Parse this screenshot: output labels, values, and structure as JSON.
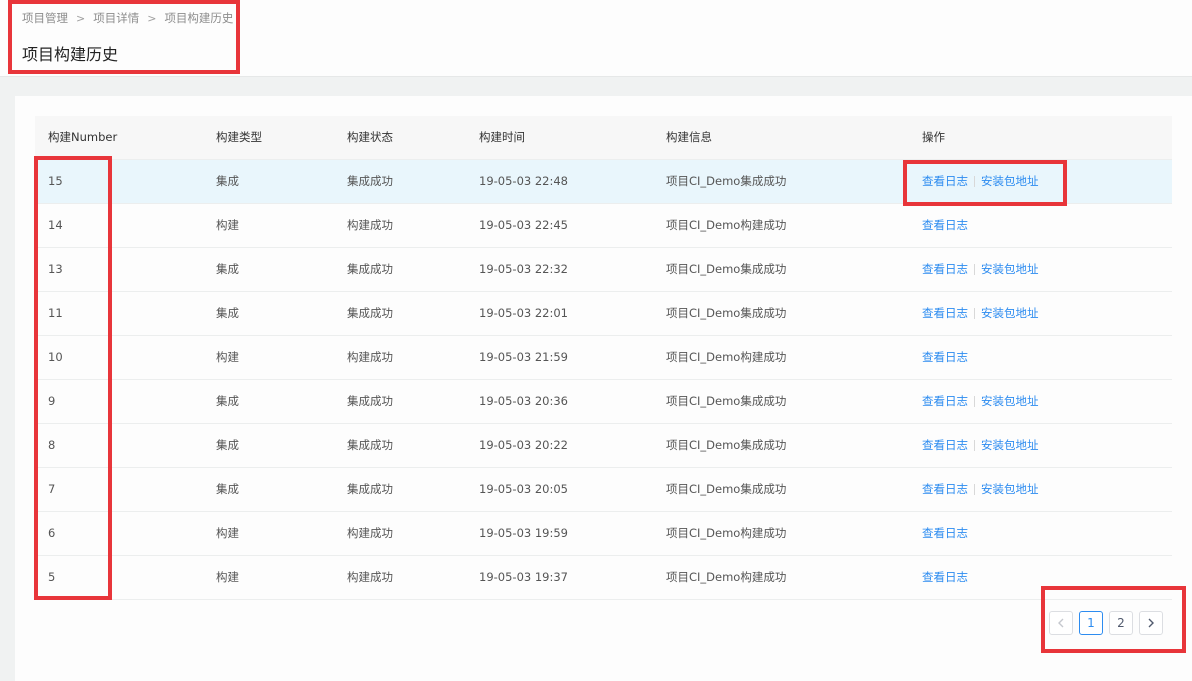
{
  "breadcrumb": {
    "items": [
      "项目管理",
      "项目详情",
      "项目构建历史"
    ],
    "separator": ">"
  },
  "page_title": "项目构建历史",
  "table": {
    "columns": [
      "构建Number",
      "构建类型",
      "构建状态",
      "构建时间",
      "构建信息",
      "操作"
    ],
    "rows": [
      {
        "number": "15",
        "type": "集成",
        "status": "集成成功",
        "time": "19-05-03 22:48",
        "info": "项目CI_Demo集成成功",
        "actions": [
          "查看日志",
          "安装包地址"
        ]
      },
      {
        "number": "14",
        "type": "构建",
        "status": "构建成功",
        "time": "19-05-03 22:45",
        "info": "项目CI_Demo构建成功",
        "actions": [
          "查看日志"
        ]
      },
      {
        "number": "13",
        "type": "集成",
        "status": "集成成功",
        "time": "19-05-03 22:32",
        "info": "项目CI_Demo集成成功",
        "actions": [
          "查看日志",
          "安装包地址"
        ]
      },
      {
        "number": "11",
        "type": "集成",
        "status": "集成成功",
        "time": "19-05-03 22:01",
        "info": "项目CI_Demo集成成功",
        "actions": [
          "查看日志",
          "安装包地址"
        ]
      },
      {
        "number": "10",
        "type": "构建",
        "status": "构建成功",
        "time": "19-05-03 21:59",
        "info": "项目CI_Demo构建成功",
        "actions": [
          "查看日志"
        ]
      },
      {
        "number": "9",
        "type": "集成",
        "status": "集成成功",
        "time": "19-05-03 20:36",
        "info": "项目CI_Demo集成成功",
        "actions": [
          "查看日志",
          "安装包地址"
        ]
      },
      {
        "number": "8",
        "type": "集成",
        "status": "集成成功",
        "time": "19-05-03 20:22",
        "info": "项目CI_Demo集成成功",
        "actions": [
          "查看日志",
          "安装包地址"
        ]
      },
      {
        "number": "7",
        "type": "集成",
        "status": "集成成功",
        "time": "19-05-03 20:05",
        "info": "项目CI_Demo集成成功",
        "actions": [
          "查看日志",
          "安装包地址"
        ]
      },
      {
        "number": "6",
        "type": "构建",
        "status": "构建成功",
        "time": "19-05-03 19:59",
        "info": "项目CI_Demo构建成功",
        "actions": [
          "查看日志"
        ]
      },
      {
        "number": "5",
        "type": "构建",
        "status": "构建成功",
        "time": "19-05-03 19:37",
        "info": "项目CI_Demo构建成功",
        "actions": [
          "查看日志"
        ]
      }
    ]
  },
  "pagination": {
    "prev_icon": "chevron-left-icon",
    "next_icon": "chevron-right-icon",
    "pages": [
      "1",
      "2"
    ],
    "current": "1"
  },
  "colors": {
    "accent": "#2d8cf0",
    "highlight_row": "#e9f6fc",
    "annotation_box": "#e8353a"
  }
}
